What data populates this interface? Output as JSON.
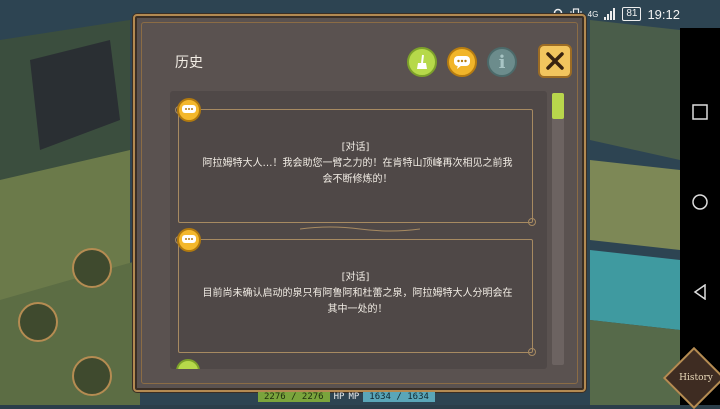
{
  "statusbar": {
    "network": "4G",
    "battery": "81",
    "time": "19:12"
  },
  "dialog": {
    "title": "历史",
    "info_icon_glyph": "i"
  },
  "entries": [
    {
      "kind": "[对话]",
      "text": "阿拉姆特大人…！我会助您一臂之力的！在肯特山顶峰再次相见之前我会不断修炼的！"
    },
    {
      "kind": "[对话]",
      "text": "目前尚未确认启动的泉只有阿鲁阿和杜蕾之泉，阿拉姆特大人分明会在其中一处的！"
    }
  ],
  "hud": {
    "hp_value": "2276 / 2276",
    "hp_label": "HP",
    "mp_label": "MP",
    "mp_value": "1634 / 1634"
  },
  "history_button": {
    "label": "History"
  },
  "colors": {
    "panel": "#5a5250",
    "frame": "#b38a52",
    "accent_green": "#b6d94a",
    "accent_yellow": "#f1b52a"
  }
}
